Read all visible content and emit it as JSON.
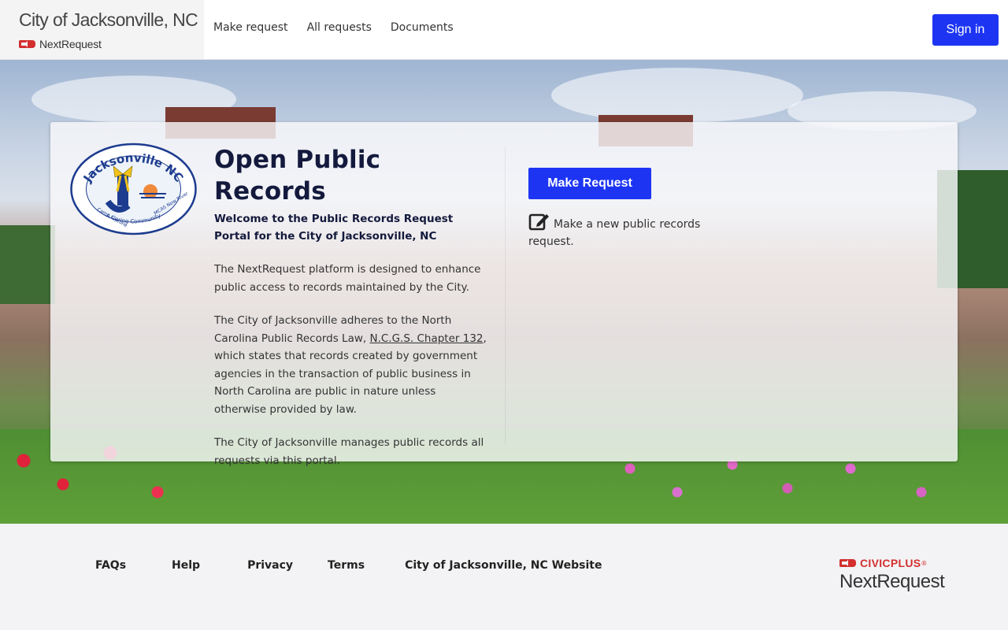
{
  "header": {
    "city_title": "City of Jacksonville, NC",
    "product_name": "NextRequest",
    "nav": [
      "Make request",
      "All requests",
      "Documents"
    ],
    "sign_in_label": "Sign in"
  },
  "card": {
    "logo": {
      "top_text": "Jacksonville NC",
      "left_text": "Camp Lejeune",
      "right_text": "MCAS New River",
      "bottom_text": "A Caring Community"
    },
    "title": "Open Public Records",
    "welcome": "Welcome to the Public Records Request Portal for the City of Jacksonville, NC",
    "para1": "The NextRequest platform is designed to enhance public access to records maintained by the City.",
    "para2_before": "The City of Jacksonville adheres to the North Carolina Public Records Law, ",
    "para2_link": "N.C.G.S. Chapter 132",
    "para2_after": ", which states that records created by government agencies in the transaction of public business in North Carolina are public in nature unless otherwise provided by law.",
    "para3": "The City of Jacksonville manages public records all requests via this portal.",
    "make_request_label": "Make Request",
    "make_request_desc": "Make a new public records request."
  },
  "footer": {
    "links": [
      "FAQs",
      "Help",
      "Privacy",
      "Terms",
      "City of Jacksonville, NC Website"
    ],
    "civicplus": "CIVICPLUS",
    "trademark": "®",
    "product": "NextRequest"
  },
  "colors": {
    "primary_button": "#1d35f3",
    "brand_red": "#d32f2f",
    "title_navy": "#141a3d"
  },
  "icons": [
    "civicplus-logo-icon",
    "edit-icon",
    "city-seal-logo"
  ]
}
